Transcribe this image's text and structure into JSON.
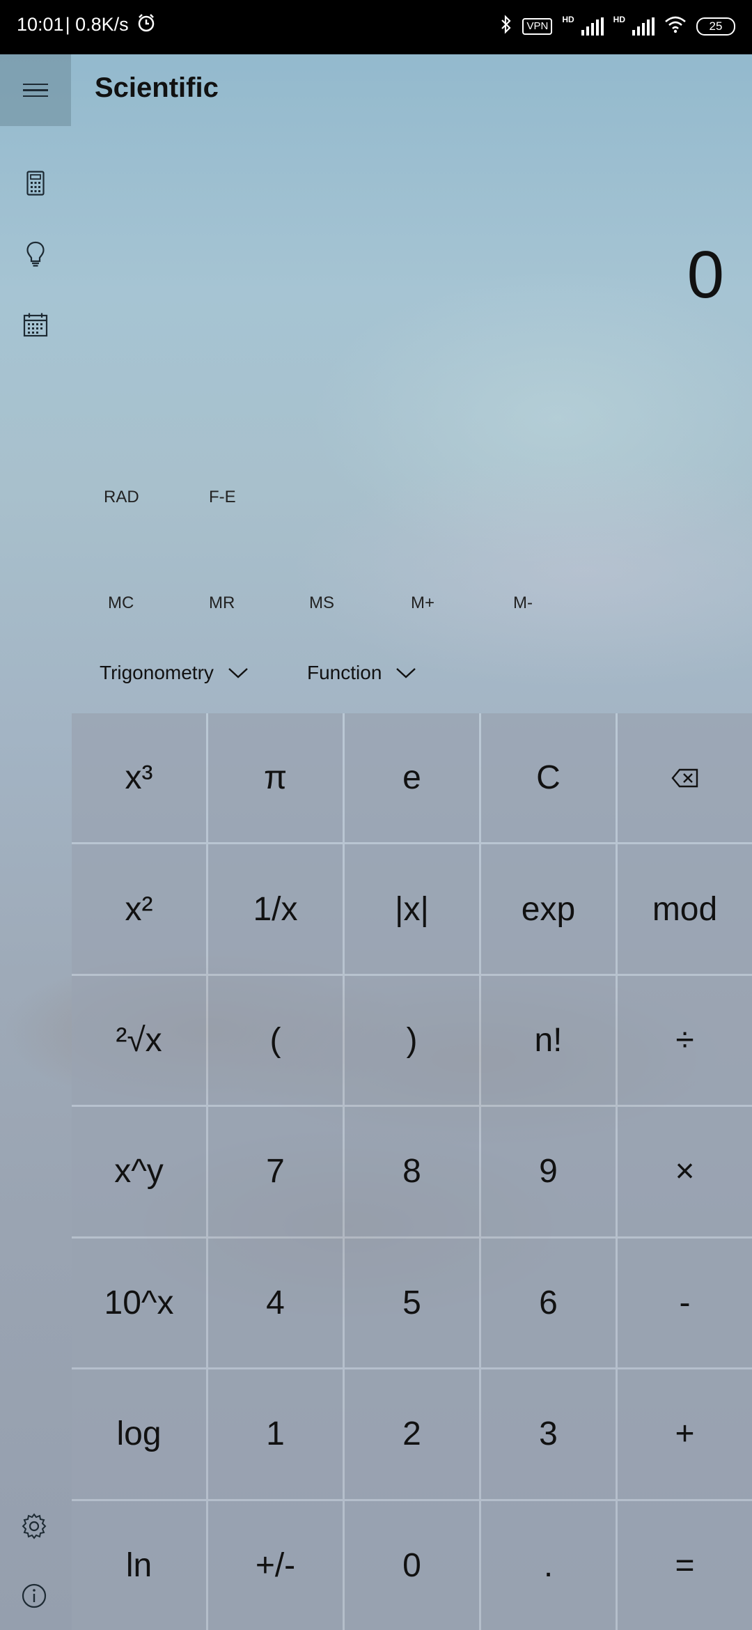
{
  "status_bar": {
    "time": "10:01",
    "speed": "| 0.8K/s",
    "vpn": "VPN",
    "hd1": "HD",
    "hd2": "HD",
    "battery": "25"
  },
  "app": {
    "title": "Scientific",
    "display_value": "0"
  },
  "modes": {
    "angle": "RAD",
    "notation": "F-E"
  },
  "memory": [
    "MC",
    "MR",
    "MS",
    "M+",
    "M-"
  ],
  "dropdowns": {
    "trigonometry": "Trigonometry",
    "function": "Function"
  },
  "keys": [
    [
      "x³",
      "π",
      "e",
      "C",
      "⌫"
    ],
    [
      "x²",
      "1/x",
      "|x|",
      "exp",
      "mod"
    ],
    [
      "²√x",
      "(",
      ")",
      "n!",
      "÷"
    ],
    [
      "x^y",
      "7",
      "8",
      "9",
      "×"
    ],
    [
      "10^x",
      "4",
      "5",
      "6",
      "-"
    ],
    [
      "log",
      "1",
      "2",
      "3",
      "+"
    ],
    [
      "ln",
      "+/-",
      "0",
      ".",
      "="
    ]
  ]
}
